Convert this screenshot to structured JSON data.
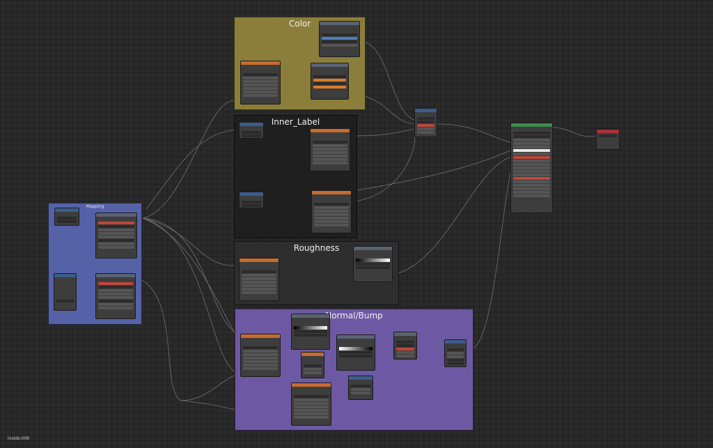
{
  "frames": {
    "color": "Color",
    "inner_label": "Inner_Label",
    "roughness": "Roughness",
    "normal_bump": "Normal/Bump",
    "mapping": "Mapping"
  },
  "footer": "inside.006",
  "colors": {
    "canvas": "#2a2a2a",
    "frame_color": "#8b7e3a",
    "frame_inner_label": "#1f1f1f",
    "frame_roughness": "#2e2e2e",
    "frame_normal": "#6d59a3",
    "frame_mapping": "#5662a8",
    "header_image": "#c96b2e",
    "header_input": "#3b5d8c",
    "header_shader": "#3b8c4d",
    "header_output": "#a5343a",
    "header_converter": "#5a6273"
  },
  "icons": [
    "texture-coordinate-icon",
    "mapping-icon",
    "image-texture-icon",
    "color-ramp-icon",
    "mix-rgb-icon",
    "principled-bsdf-icon",
    "material-output-icon",
    "normal-map-icon",
    "bump-icon",
    "math-icon"
  ]
}
